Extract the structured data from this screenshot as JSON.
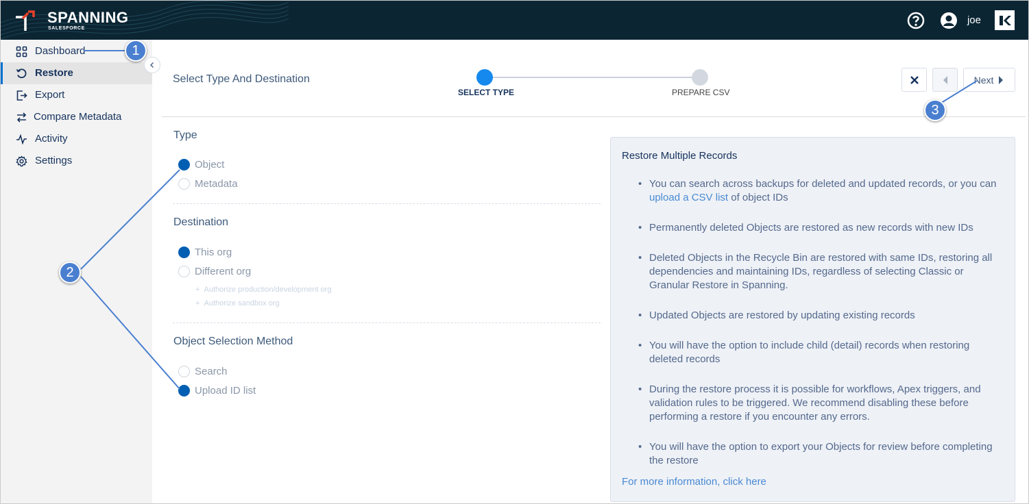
{
  "header": {
    "logo_title": "SPANNING",
    "logo_sub": "SALESFORCE",
    "user_name": "joe",
    "help_icon": "help-circle-icon",
    "user_icon": "user-circle-icon",
    "brand_icon": "kaseya-icon"
  },
  "sidebar": {
    "items": [
      {
        "label": "Dashboard",
        "icon": "grid-icon"
      },
      {
        "label": "Restore",
        "icon": "restore-icon",
        "active": true
      },
      {
        "label": "Export",
        "icon": "export-icon"
      },
      {
        "label": "Compare Metadata",
        "icon": "compare-icon"
      },
      {
        "label": "Activity",
        "icon": "activity-icon"
      },
      {
        "label": "Settings",
        "icon": "gear-icon"
      }
    ]
  },
  "main": {
    "title": "Select Type And Destination",
    "steps": [
      {
        "label": "SELECT TYPE",
        "active": true
      },
      {
        "label": "PREPARE CSV",
        "active": false
      }
    ],
    "next_label": "Next",
    "type": {
      "title": "Type",
      "options": [
        {
          "label": "Object",
          "selected": true
        },
        {
          "label": "Metadata",
          "selected": false
        }
      ]
    },
    "destination": {
      "title": "Destination",
      "options": [
        {
          "label": "This org",
          "selected": true
        },
        {
          "label": "Different org",
          "selected": false
        }
      ],
      "links": [
        "Authorize production/development org",
        "Authorize sandbox org"
      ]
    },
    "method": {
      "title": "Object Selection Method",
      "options": [
        {
          "label": "Search",
          "selected": false
        },
        {
          "label": "Upload ID list",
          "selected": true
        }
      ]
    }
  },
  "info": {
    "title": "Restore Multiple Records",
    "b1_pre": "You can search across backups for deleted and updated records, or you can ",
    "b1_link": "upload a CSV list",
    "b1_post": " of object IDs",
    "bullets": [
      "Permanently deleted Objects are restored as new records with new IDs",
      "Deleted Objects in the Recycle Bin are restored with same IDs, restoring all dependencies and maintaining IDs, regardless of selecting Classic or Granular Restore in Spanning.",
      "Updated Objects are restored by updating existing records",
      "You will have the option to include child (detail) records when restoring deleted records",
      "During the restore process it is possible for workflows, Apex triggers, and validation rules to be triggered. We recommend disabling these before performing a restore if you encounter any errors.",
      "You will have the option to export your Objects for review before completing the restore"
    ],
    "more_link": "For more information, click here"
  },
  "callouts": [
    "1",
    "2",
    "3"
  ],
  "colors": {
    "header_bg": "#0b2533",
    "accent": "#005fb2",
    "step_active": "#1589ee",
    "callout": "#4a7fd0"
  }
}
